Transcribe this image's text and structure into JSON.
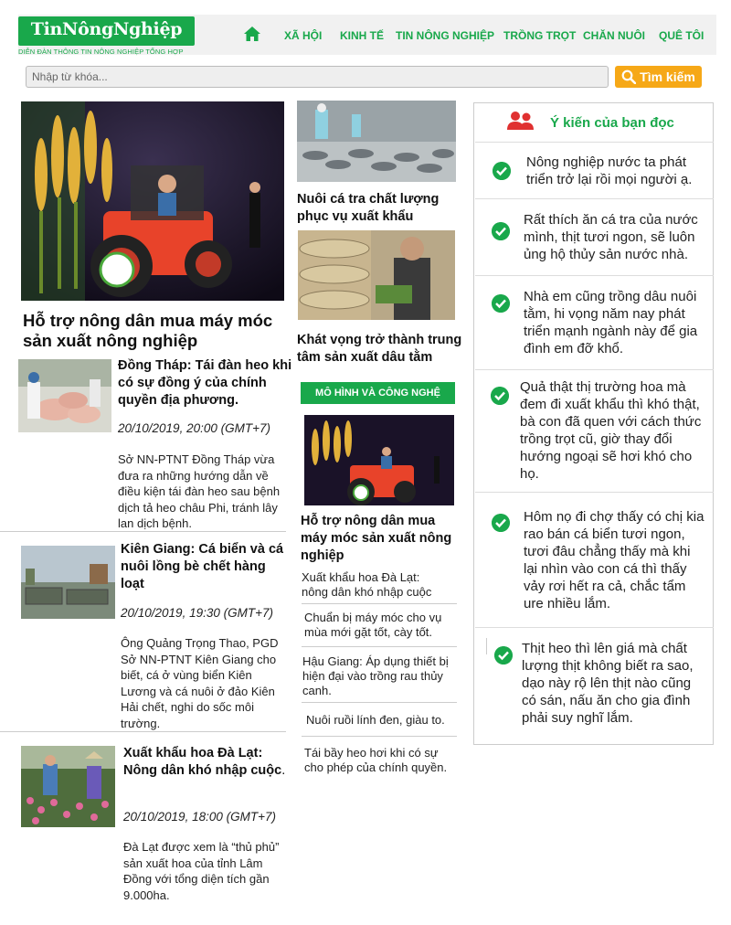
{
  "site": {
    "logo_text": "TinNôngNghiệp",
    "logo_subtitle": "DIỄN ĐÀN THÔNG TIN NÔNG NGHIỆP TỔNG HỢP",
    "brand_color": "#19a84b",
    "accent_color": "#f6a817"
  },
  "nav": {
    "home_icon": "home-icon",
    "items": [
      "XÃ HỘI",
      "KINH TẾ",
      "TIN NÔNG NGHIỆP",
      "TRỒNG TRỌT",
      "CHĂN NUÔI",
      "QUÊ TÔI"
    ]
  },
  "search": {
    "placeholder": "Nhập từ khóa...",
    "button_label": "Tìm kiếm",
    "icon": "search-icon"
  },
  "featured": {
    "title": "Hỗ trợ nông dân mua máy móc sản xuất nông nghiệp",
    "image": "tractor-photo"
  },
  "articles": [
    {
      "title": "Đồng Tháp: Tái đàn heo khi có sự đồng ý của chính quyền địa phương.",
      "date": "20/10/2019, 20:00 (GMT+7)",
      "summary": "Sở NN-PTNT Đồng Tháp vừa đưa ra những hướng dẫn về điều kiện tái đàn heo sau bệnh dịch tả heo châu Phi, tránh lây lan dịch bệnh.",
      "image": "pig-farm-photo"
    },
    {
      "title": "Kiên Giang: Cá biển và cá nuôi lồng bè  chết hàng loạt",
      "date": "20/10/2019, 19:30 (GMT+7)",
      "summary": "Ông Quảng Trọng Thao, PGD Sở NN-PTNT Kiên Giang  cho biết, cá ở vùng biển Kiên Lương và cá nuôi ở đảo Kiên Hải chết, nghi do sốc môi trường.",
      "image": "fish-farm-photo"
    },
    {
      "title": "Xuất khẩu hoa Đà Lạt: Nông dân khó nhập cuộc",
      "title_suffix": ".",
      "date": "20/10/2019, 18:00 (GMT+7)",
      "summary": "Đà Lạt được xem là “thủ phủ” sản xuất hoa của tỉnh Lâm Đồng với tổng diện tích gần 9.000ha.",
      "image": "flower-farm-photo"
    }
  ],
  "middle": {
    "story1_title": "Nuôi cá tra chất lượng phục vụ xuất khẩu",
    "story2_title": "Khát vọng trở thành trung tâm sản xuất dâu tằm",
    "section_tag": "MÔ HÌNH VÀ CÔNG NGHỆ",
    "section_feature_title": "Hỗ trợ nông dân mua máy móc sản xuất nông nghiệp",
    "links": [
      "Xuất khẩu hoa Đà Lạt: nông dân khó nhập cuộc",
      "Chuẩn bị máy móc cho vụ mùa mới gặt tốt, cày tốt.",
      "Hậu Giang: Áp dụng thiết bị hiện đại vào trồng rau thủy canh.",
      "Nuôi ruồi lính đen, giàu to.",
      "Tái bầy heo hơi khi có sự cho phép của chính quyền."
    ]
  },
  "comments": {
    "header": "Ý kiến của bạn đọc",
    "header_icon": "users-icon",
    "items": [
      "Nông nghiệp nước ta phát triển trở lại rồi mọi người ạ.",
      "Rất thích ăn cá tra của nước mình, thịt tươi ngon, sẽ luôn ủng hộ thủy sản nước nhà.",
      "Nhà em cũng trồng dâu nuôi tằm, hi vọng năm nay phát triển mạnh ngành này để gia đình em đỡ khổ.",
      "Quả thật thị trường hoa mà đem đi xuất khẩu thì khó thật, bà con đã quen với cách thức trồng trọt cũ, giờ thay đổi hướng ngoại sẽ hơi khó cho họ.",
      "Hôm nọ đi chợ thấy có chị kia rao bán cá biển tươi ngon, tươi đâu chẳng thấy mà khi lại nhìn vào con cá thì thấy vảy rơi hết ra cả, chắc tẩm ure nhiều lắm.",
      "Thịt heo thì lên giá mà chất lượng thịt không biết ra sao, dạo này rộ lên thịt nào cũng có sán, nấu ăn cho gia đình phải suy nghĩ lắm."
    ]
  }
}
